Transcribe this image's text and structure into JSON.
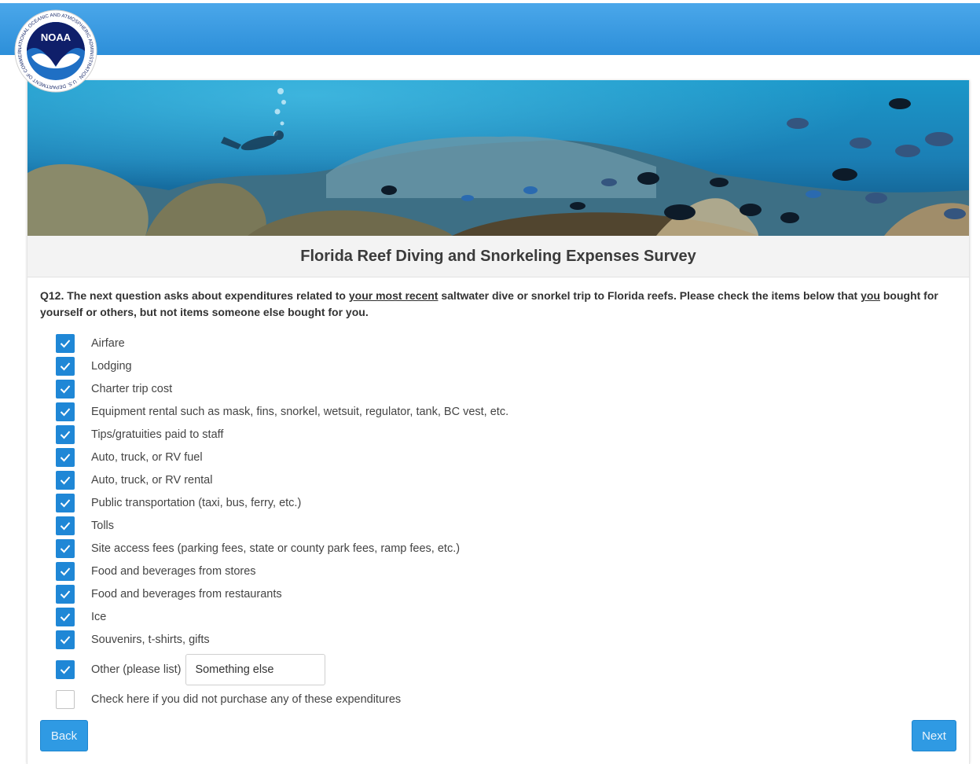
{
  "header": {
    "logo_text": "NOAA",
    "logo_ring_text": "NATIONAL OCEANIC AND ATMOSPHERIC ADMINISTRATION · U.S. DEPARTMENT OF COMMERCE"
  },
  "survey": {
    "title": "Florida Reef Diving and Snorkeling Expenses Survey"
  },
  "question": {
    "part1": "Q12. The next question asks about expenditures related to ",
    "emph1": "your most recent",
    "part2": " saltwater dive or snorkel trip to Florida reefs. Please check the items below that ",
    "emph2": "you",
    "part3": " bought for yourself or others, but not items someone else bought for you."
  },
  "options": [
    {
      "label": "Airfare",
      "checked": true
    },
    {
      "label": "Lodging",
      "checked": true
    },
    {
      "label": "Charter trip cost",
      "checked": true
    },
    {
      "label": "Equipment rental such as mask, fins, snorkel, wetsuit, regulator, tank, BC vest, etc.",
      "checked": true
    },
    {
      "label": "Tips/gratuities paid to staff",
      "checked": true
    },
    {
      "label": "Auto, truck, or RV fuel",
      "checked": true
    },
    {
      "label": "Auto, truck, or RV rental",
      "checked": true
    },
    {
      "label": "Public transportation (taxi, bus, ferry, etc.)",
      "checked": true
    },
    {
      "label": "Tolls",
      "checked": true
    },
    {
      "label": "Site access fees (parking fees, state or county park fees, ramp fees, etc.)",
      "checked": true
    },
    {
      "label": "Food and beverages from stores",
      "checked": true
    },
    {
      "label": "Food and beverages from restaurants",
      "checked": true
    },
    {
      "label": "Ice",
      "checked": true
    },
    {
      "label": "Souvenirs, t-shirts, gifts",
      "checked": true
    }
  ],
  "other": {
    "label": "Other (please list)",
    "checked": true,
    "value": "Something else"
  },
  "none": {
    "label": "Check here if you did not purchase any of these expenditures",
    "checked": false
  },
  "nav": {
    "back_label": "Back",
    "next_label": "Next"
  },
  "colors": {
    "accent": "#2f9ae3",
    "checkbox": "#1f87d6",
    "header": "#3d9fe6"
  }
}
